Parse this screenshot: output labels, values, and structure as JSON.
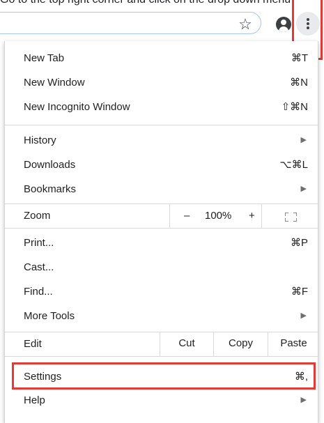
{
  "instruction": "Go to the top right corner and click on the drop down menu",
  "toolbar": {
    "star_icon": "star-icon",
    "avatar_icon": "account-icon",
    "menu_icon": "three-dots-vertical-icon"
  },
  "menu": {
    "new_tab": {
      "label": "New Tab",
      "shortcut": "⌘T"
    },
    "new_window": {
      "label": "New Window",
      "shortcut": "⌘N"
    },
    "new_incognito": {
      "label": "New Incognito Window",
      "shortcut": "⇧⌘N"
    },
    "history": {
      "label": "History"
    },
    "downloads": {
      "label": "Downloads",
      "shortcut": "⌥⌘L"
    },
    "bookmarks": {
      "label": "Bookmarks"
    },
    "zoom": {
      "label": "Zoom",
      "minus": "–",
      "value": "100%",
      "plus": "+"
    },
    "print": {
      "label": "Print...",
      "shortcut": "⌘P"
    },
    "cast": {
      "label": "Cast..."
    },
    "find": {
      "label": "Find...",
      "shortcut": "⌘F"
    },
    "more_tools": {
      "label": "More Tools"
    },
    "edit": {
      "label": "Edit",
      "cut": "Cut",
      "copy": "Copy",
      "paste": "Paste"
    },
    "settings": {
      "label": "Settings",
      "shortcut": "⌘,"
    },
    "help": {
      "label": "Help"
    }
  },
  "colors": {
    "highlight": "#e53935",
    "menu_button_bg": "#e8eaed"
  }
}
